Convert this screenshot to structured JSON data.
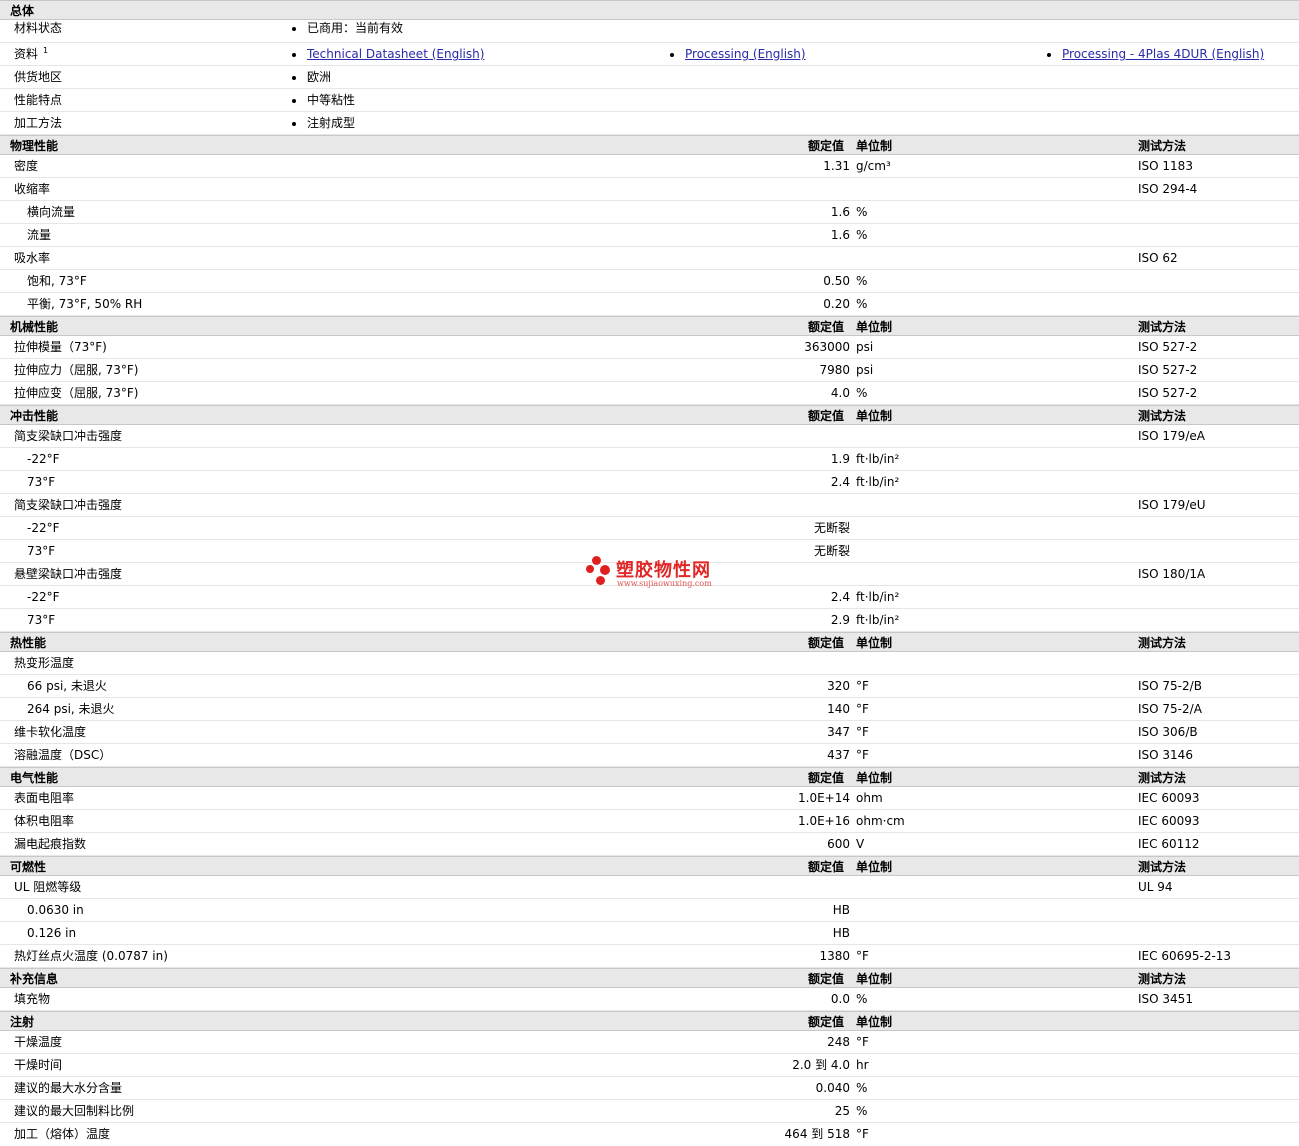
{
  "sections": [
    {
      "title": "总体",
      "type": "general",
      "rows": [
        {
          "label": "材料状态",
          "items": [
            "已商用：当前有效"
          ]
        },
        {
          "label": "资料",
          "sup": "1",
          "links": [
            "Technical Datasheet (English)",
            "Processing (English)",
            "Processing - 4Plas 4DUR (English)"
          ]
        },
        {
          "label": "供货地区",
          "items": [
            "欧洲"
          ]
        },
        {
          "label": "性能特点",
          "items": [
            "中等粘性"
          ]
        },
        {
          "label": "加工方法",
          "items": [
            "注射成型"
          ]
        }
      ]
    },
    {
      "title": "物理性能",
      "col_value": "额定值",
      "col_unit": "单位制",
      "col_method": "测试方法",
      "rows": [
        {
          "label": "密度",
          "value": "1.31",
          "unit": "g/cm³",
          "method": "ISO 1183"
        },
        {
          "label": "收缩率",
          "method": "ISO 294-4"
        },
        {
          "label": "横向流量",
          "sub": true,
          "value": "1.6",
          "unit": "%"
        },
        {
          "label": "流量",
          "sub": true,
          "value": "1.6",
          "unit": "%"
        },
        {
          "label": "吸水率",
          "method": "ISO 62"
        },
        {
          "label": "饱和, 73°F",
          "sub": true,
          "value": "0.50",
          "unit": "%"
        },
        {
          "label": "平衡, 73°F, 50% RH",
          "sub": true,
          "value": "0.20",
          "unit": "%"
        }
      ]
    },
    {
      "title": "机械性能",
      "col_value": "额定值",
      "col_unit": "单位制",
      "col_method": "测试方法",
      "rows": [
        {
          "label": "拉伸模量（73°F)",
          "value": "363000",
          "unit": "psi",
          "method": "ISO 527-2"
        },
        {
          "label": "拉伸应力（屈服, 73°F)",
          "value": "7980",
          "unit": "psi",
          "method": "ISO 527-2"
        },
        {
          "label": "拉伸应变（屈服, 73°F)",
          "value": "4.0",
          "unit": "%",
          "method": "ISO 527-2"
        }
      ]
    },
    {
      "title": "冲击性能",
      "col_value": "额定值",
      "col_unit": "单位制",
      "col_method": "测试方法",
      "rows": [
        {
          "label": "简支梁缺口冲击强度",
          "method": "ISO 179/eA"
        },
        {
          "label": "-22°F",
          "sub": true,
          "value": "1.9",
          "unit": "ft·lb/in²"
        },
        {
          "label": "73°F",
          "sub": true,
          "value": "2.4",
          "unit": "ft·lb/in²"
        },
        {
          "label": "简支梁缺口冲击强度",
          "method": "ISO 179/eU"
        },
        {
          "label": "-22°F",
          "sub": true,
          "value": "无断裂"
        },
        {
          "label": "73°F",
          "sub": true,
          "value": "无断裂"
        },
        {
          "label": "悬壁梁缺口冲击强度",
          "method": "ISO 180/1A"
        },
        {
          "label": "-22°F",
          "sub": true,
          "value": "2.4",
          "unit": "ft·lb/in²"
        },
        {
          "label": "73°F",
          "sub": true,
          "value": "2.9",
          "unit": "ft·lb/in²"
        }
      ]
    },
    {
      "title": "热性能",
      "col_value": "额定值",
      "col_unit": "单位制",
      "col_method": "测试方法",
      "rows": [
        {
          "label": "热变形温度"
        },
        {
          "label": "66 psi, 未退火",
          "sub": true,
          "value": "320",
          "unit": "°F",
          "method": "ISO 75-2/B"
        },
        {
          "label": "264 psi, 未退火",
          "sub": true,
          "value": "140",
          "unit": "°F",
          "method": "ISO 75-2/A"
        },
        {
          "label": "维卡软化温度",
          "value": "347",
          "unit": "°F",
          "method": "ISO 306/B"
        },
        {
          "label": "溶融温度（DSC）",
          "value": "437",
          "unit": "°F",
          "method": "ISO 3146"
        }
      ]
    },
    {
      "title": "电气性能",
      "col_value": "额定值",
      "col_unit": "单位制",
      "col_method": "测试方法",
      "rows": [
        {
          "label": "表面电阻率",
          "value": "1.0E+14",
          "unit": "ohm",
          "method": "IEC 60093"
        },
        {
          "label": "体积电阻率",
          "value": "1.0E+16",
          "unit": "ohm·cm",
          "method": "IEC 60093"
        },
        {
          "label": "漏电起痕指数",
          "value": "600",
          "unit": "V",
          "method": "IEC 60112"
        }
      ]
    },
    {
      "title": "可燃性",
      "col_value": "额定值",
      "col_unit": "单位制",
      "col_method": "测试方法",
      "rows": [
        {
          "label": "UL 阻燃等级",
          "method": "UL 94"
        },
        {
          "label": "0.0630 in",
          "sub": true,
          "value": "HB"
        },
        {
          "label": "0.126 in",
          "sub": true,
          "value": "HB"
        },
        {
          "label": "热灯丝点火温度 (0.0787 in)",
          "value": "1380",
          "unit": "°F",
          "method": "IEC 60695-2-13"
        }
      ]
    },
    {
      "title": "补充信息",
      "col_value": "额定值",
      "col_unit": "单位制",
      "col_method": "测试方法",
      "rows": [
        {
          "label": "填充物",
          "value": "0.0",
          "unit": "%",
          "method": "ISO 3451"
        }
      ]
    },
    {
      "title": "注射",
      "col_value": "额定值",
      "col_unit": "单位制",
      "rows": [
        {
          "label": "干燥温度",
          "value": "248",
          "unit": "°F"
        },
        {
          "label": "干燥时间",
          "value": "2.0 到  4.0",
          "unit": "hr"
        },
        {
          "label": "建议的最大水分含量",
          "value": "0.040",
          "unit": "%"
        },
        {
          "label": "建议的最大回制料比例",
          "value": "25",
          "unit": "%"
        },
        {
          "label": "加工（熔体）温度",
          "value": "464 到  518",
          "unit": "°F"
        }
      ]
    }
  ],
  "watermark": {
    "text": "塑胶物性网",
    "url": "www.sujiaowuxing.com"
  }
}
